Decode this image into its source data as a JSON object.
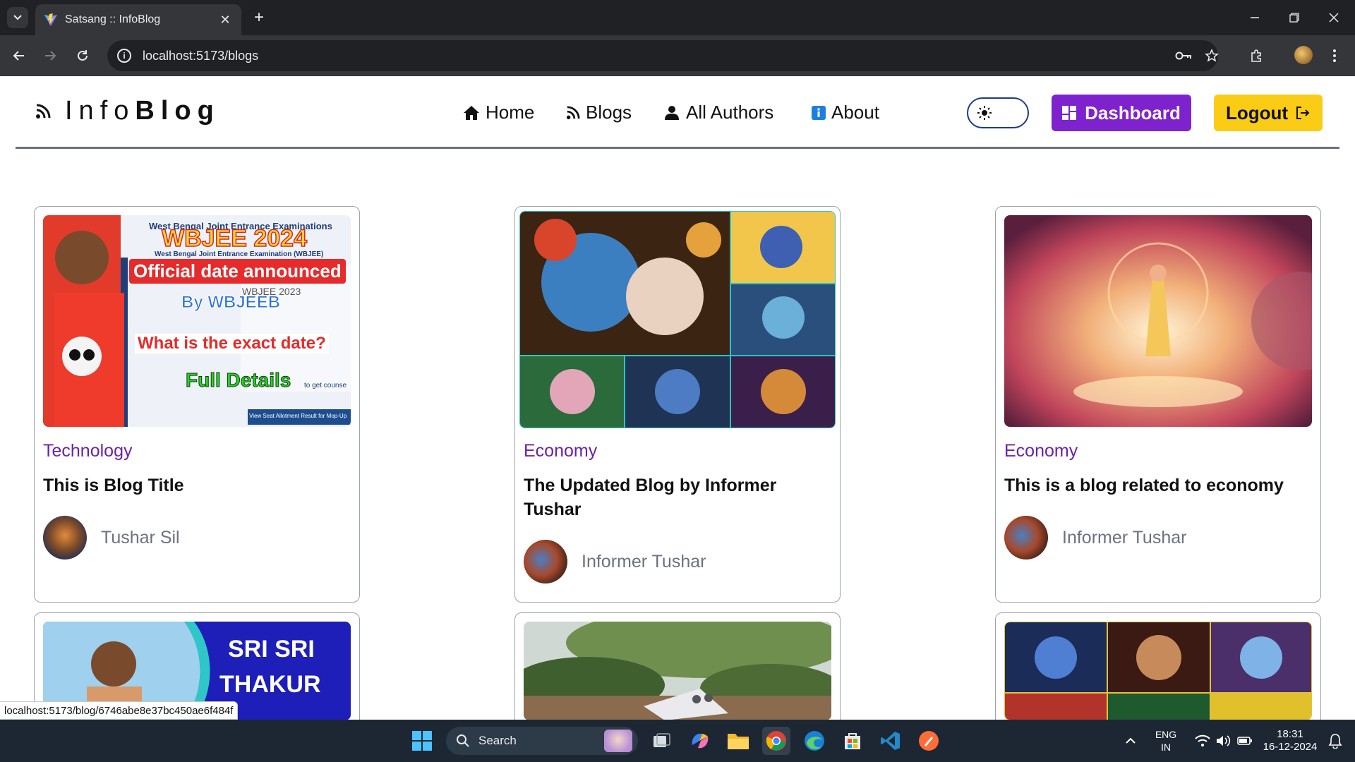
{
  "browser": {
    "tab_title": "Satsang :: InfoBlog",
    "new_tab_symbol": "+",
    "url": "localhost:5173/blogs",
    "status_url": "localhost:5173/blog/6746abe8e37bc450ae6f484f"
  },
  "site": {
    "logo_info": "Info",
    "logo_blog": "Blog",
    "nav": [
      {
        "label": "Home",
        "icon": "home-icon"
      },
      {
        "label": "Blogs",
        "icon": "rss-icon"
      },
      {
        "label": "All Authors",
        "icon": "user-icon"
      },
      {
        "label": "About",
        "icon": "info-icon"
      }
    ],
    "theme_toggle_icon": "sun-icon",
    "dashboard_label": "Dashboard",
    "logout_label": "Logout"
  },
  "blogs": [
    {
      "image_text": [
        "West Bengal Joint Entrance Examinations",
        "WBJEE 2024",
        "West Bengal Joint Entrance Examination (WBJEE)",
        "Official date announced",
        "WBJEE 2023",
        "By WBJEEB",
        "What is the exact date?",
        "Full Details",
        "to get counse",
        "View Seat Allotment Result for Mop-Up"
      ],
      "category": "Technology",
      "title": "This is Blog Title",
      "author": "Tushar Sil"
    },
    {
      "category": "Economy",
      "title": "The Updated Blog by Informer Tushar",
      "author": "Informer Tushar"
    },
    {
      "category": "Economy",
      "title": "This is a blog related to economy",
      "author": "Informer Tushar"
    },
    {
      "image_text": [
        "SRI SRI",
        "THAKUR"
      ]
    },
    {},
    {}
  ],
  "taskbar": {
    "search_label": "Search",
    "lang_top": "ENG",
    "lang_bottom": "IN",
    "time": "18:31",
    "date": "16-12-2024"
  }
}
